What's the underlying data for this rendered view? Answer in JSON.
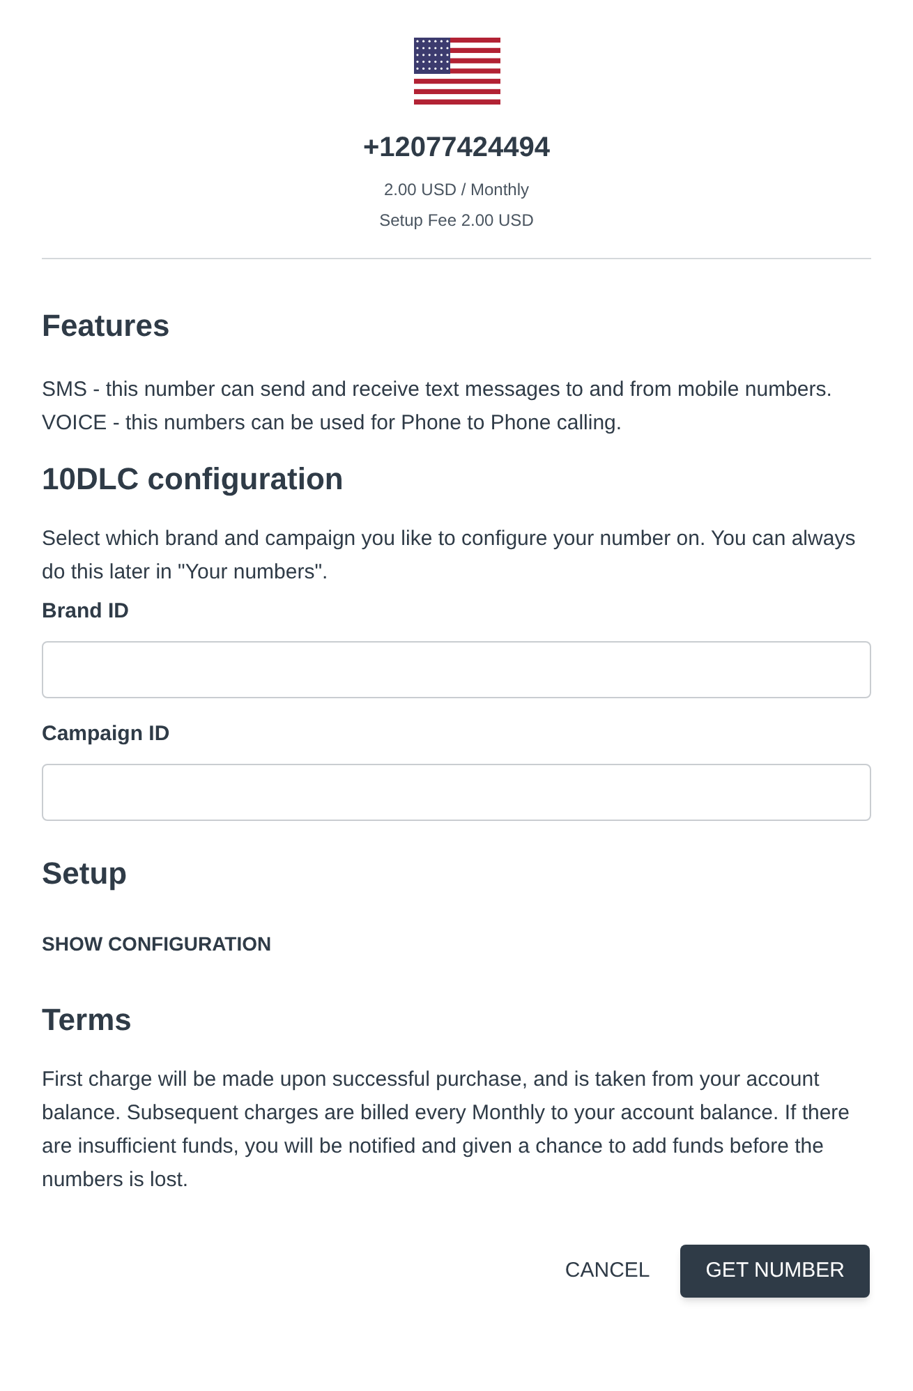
{
  "number": {
    "phone": "+12077424494",
    "price": "2.00 USD / Monthly",
    "setup_fee": "Setup Fee 2.00 USD"
  },
  "features": {
    "title": "Features",
    "lines": [
      "SMS - this number can send and receive text messages to and from mobile numbers.",
      "VOICE - this numbers can be used for Phone to Phone calling."
    ]
  },
  "config": {
    "title": "10DLC configuration",
    "description": "Select which brand and campaign you like to configure your number on. You can always do this later in \"Your numbers\".",
    "fields": [
      {
        "label": "Brand ID"
      },
      {
        "label": "Campaign ID"
      }
    ]
  },
  "setup": {
    "title": "Setup",
    "toggle": "SHOW CONFIGURATION"
  },
  "terms": {
    "title": "Terms",
    "text": "First charge will be made upon successful purchase, and is taken from your account balance. Subsequent charges are billed every Monthly to your account balance. If there are insufficient funds, you will be notified and given a chance to add funds before the numbers is lost."
  },
  "buttons": [
    {
      "label": "CANCEL",
      "kind": "text"
    },
    {
      "label": "GET NUMBER",
      "kind": "primary"
    }
  ]
}
